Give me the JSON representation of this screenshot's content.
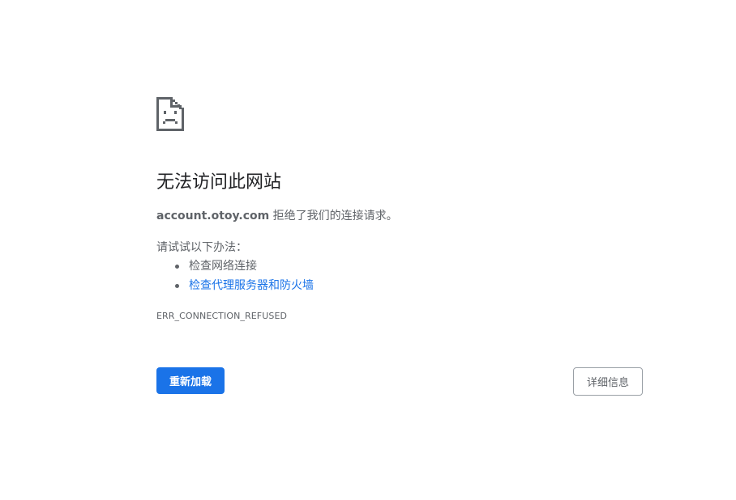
{
  "icon": "sad-page-icon",
  "title": "无法访问此网站",
  "message": {
    "host": "account.otoy.com",
    "text": " 拒绝了我们的连接请求。"
  },
  "suggestions": {
    "label": "请试试以下办法：",
    "items": [
      "检查网络连接",
      "检查代理服务器和防火墙"
    ]
  },
  "error_code": "ERR_CONNECTION_REFUSED",
  "buttons": {
    "reload": "重新加载",
    "details": "详细信息"
  },
  "colors": {
    "accent": "#1a73e8",
    "text": "#5f6368",
    "title": "#202124"
  }
}
